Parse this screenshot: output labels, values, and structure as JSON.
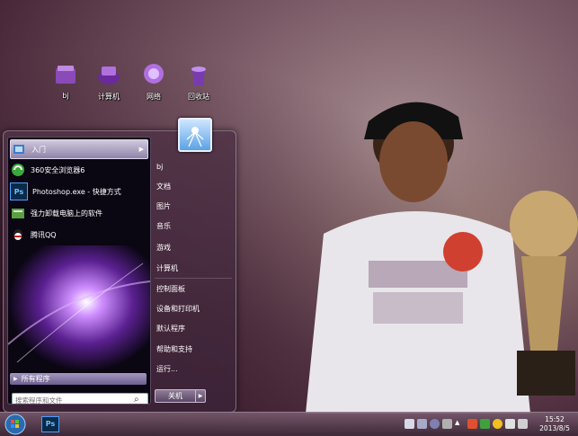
{
  "desktop": {
    "icons": [
      {
        "label": "bj",
        "icon": "folder-icon"
      },
      {
        "label": "计算机",
        "icon": "computer-icon"
      },
      {
        "label": "网络",
        "icon": "network-icon"
      },
      {
        "label": "回收站",
        "icon": "recycle-bin-icon"
      }
    ]
  },
  "start_menu": {
    "programs": [
      {
        "label": "入门",
        "icon": "getting-started-icon"
      },
      {
        "label": "360安全浏览器6",
        "icon": "browser-360-icon"
      },
      {
        "label": "Photoshop.exe - 快捷方式",
        "icon": "photoshop-icon",
        "icon_text": "Ps"
      },
      {
        "label": "强力卸载电脑上的软件",
        "icon": "uninstall-icon"
      },
      {
        "label": "腾讯QQ",
        "icon": "qq-icon"
      }
    ],
    "all_programs": "所有程序",
    "search_placeholder": "搜索程序和文件",
    "right_items": [
      "bj",
      "文档",
      "图片",
      "音乐",
      "游戏",
      "计算机",
      "控制面板",
      "设备和打印机",
      "默认程序",
      "帮助和支持",
      "运行..."
    ],
    "shutdown_label": "关机"
  },
  "taskbar": {
    "ps_icon_text": "Ps",
    "clock_time": "15:52",
    "clock_date": "2013/8/5"
  },
  "colors": {
    "accent": "#8f84a8",
    "taskbar": "#5a3c50"
  }
}
